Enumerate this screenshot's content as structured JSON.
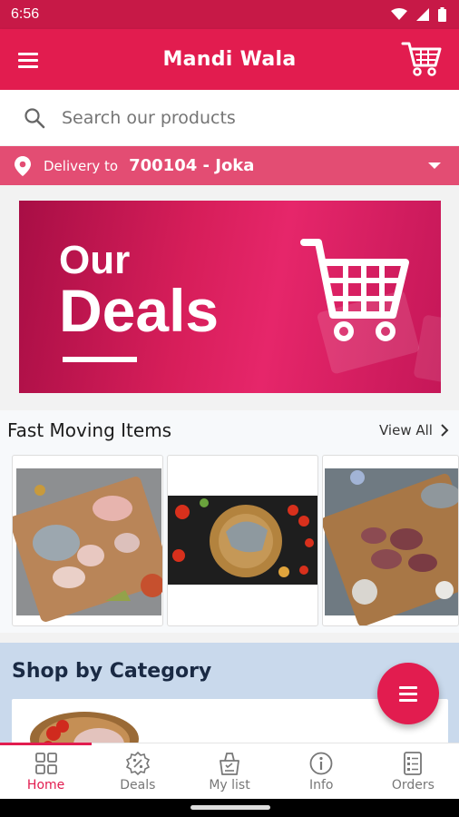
{
  "status_bar": {
    "time": "6:56"
  },
  "app_bar": {
    "title": "Mandi Wala"
  },
  "search": {
    "placeholder": "Search our products"
  },
  "delivery": {
    "label": "Delivery to",
    "value": "700104 - Joka"
  },
  "banner": {
    "line1": "Our",
    "line2": "Deals"
  },
  "fast_moving": {
    "title": "Fast Moving Items",
    "view_all": "View All",
    "products": [
      "fish-cuts-board-image",
      "fish-head-board-image",
      "fish-pieces-board-image"
    ]
  },
  "category": {
    "title": "Shop by Category"
  },
  "bottom_nav": {
    "items": [
      {
        "label": "Home",
        "icon": "grid-icon",
        "active": true
      },
      {
        "label": "Deals",
        "icon": "badge-icon",
        "active": false
      },
      {
        "label": "My list",
        "icon": "basket-icon",
        "active": false
      },
      {
        "label": "Info",
        "icon": "info-icon",
        "active": false
      },
      {
        "label": "Orders",
        "icon": "orders-icon",
        "active": false
      }
    ]
  },
  "colors": {
    "primary": "#e21c4f",
    "status": "#c71947",
    "delivery": "#e34d73",
    "category_bg": "#c9d9ec"
  }
}
